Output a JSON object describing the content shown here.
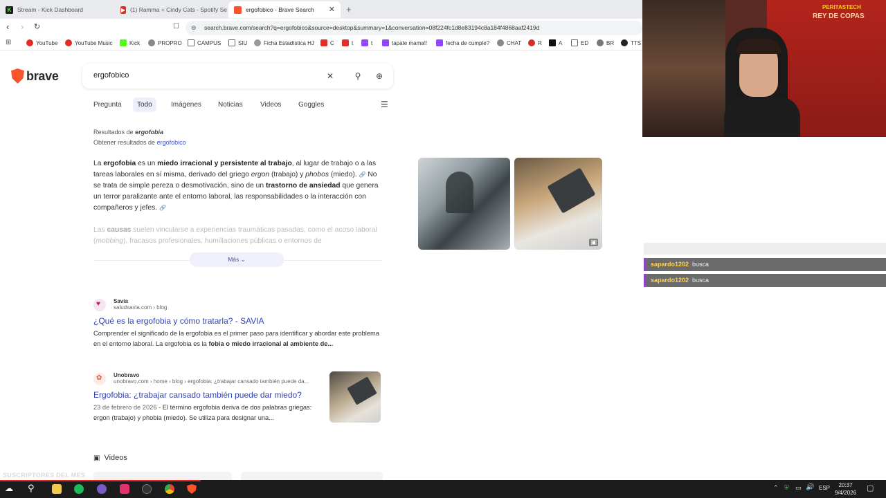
{
  "tabs": [
    {
      "title": "Stream - Kick Dashboard",
      "fav_color": "#53fc18"
    },
    {
      "title": "(1) Ramma + Cindy Cats - Spotify Se",
      "fav_color": "#e52d27"
    },
    {
      "title": "ergofobico - Brave Search",
      "fav_color": "#fb542b"
    }
  ],
  "new_tab": "+",
  "address": "search.brave.com/search?q=ergofobico&source=desktop&summary=1&conversation=08f224fc1d8e83194c8a184f4868aaf2419d",
  "bookmarks": [
    "YouTube",
    "YouTube Music",
    "Kick",
    "PROPRO",
    "CAMPUS",
    "SIU",
    "Ficha Estadística HJ",
    "C",
    "t",
    "t",
    "tapate mama!!",
    "fecha de cumple?",
    "CHAT",
    "R",
    "A",
    "ED",
    "BR",
    "TTS"
  ],
  "logo": "brave",
  "search_query": "ergofobico",
  "nav_tabs": [
    "Pregunta",
    "Todo",
    "Imágenes",
    "Noticias",
    "Videos",
    "Goggles"
  ],
  "results_for": {
    "label": "Resultados de",
    "term": "ergofobia",
    "alt_label": "Obtener resultados de",
    "alt_term": "ergofobico"
  },
  "summary": {
    "p1_a": "La ",
    "p1_b": "ergofobia",
    "p1_c": " es un ",
    "p1_d": "miedo irracional y persistente al trabajo",
    "p1_e": ", al lugar de trabajo o a las tareas laborales en sí misma, derivado del griego ",
    "p1_f": "ergon",
    "p1_g": " (trabajo) y ",
    "p1_h": "phobos",
    "p1_i": " (miedo).",
    "p1_j": " No se trata de simple pereza o desmotivación, sino de un ",
    "p1_k": "trastorno de ansiedad",
    "p1_l": " que genera un terror paralizante ante el entorno laboral, las responsabilidades o la interacción con compañeros y jefes.",
    "p2_a": "Las ",
    "p2_b": "causas",
    "p2_c": " suelen vincularse a experiencias traumáticas pasadas, como el acoso laboral (",
    "p2_d": "mobbing",
    "p2_e": "), fracasos profesionales, humillaciones públicas o entornos de"
  },
  "more_button": "Más",
  "results": [
    {
      "site": "Savia",
      "url": "saludsavia.com › blog",
      "title": "¿Qué es la ergofobia y cómo tratarla? - SAVIA",
      "desc_a": "Comprender el significado de la ergofobia es el primer paso para identificar y abordar este problema en el entorno laboral. La ergofobia es la ",
      "desc_b": "fobia o miedo irracional al ambiente de..."
    },
    {
      "site": "Unobravo",
      "url": "unobravo.com › home › blog › ergofobia: ¿trabajar cansado también puede da...",
      "title": "Ergofobia: ¿trabajar cansado también puede dar miedo?",
      "date": "23 de febrero de 2026",
      "desc_a": " - El término ergofobia deriva de dos palabras griegas: ergon (trabajo) y phobia (miedo). Se utiliza para designar una..."
    }
  ],
  "videos_heading": "Videos",
  "chat": [
    {
      "user": "sapardo1202",
      "msg": "busca"
    },
    {
      "user": "sapardo1202",
      "msg": "busca"
    }
  ],
  "overlay_text": "SUSCRIPTORES DEL MES",
  "webcam_sign": "PERITASTECH",
  "webcam_sign2": "REY DE COPAS",
  "taskbar": {
    "lang": "ESP",
    "time": "20:37",
    "date": "9/4/2026"
  }
}
